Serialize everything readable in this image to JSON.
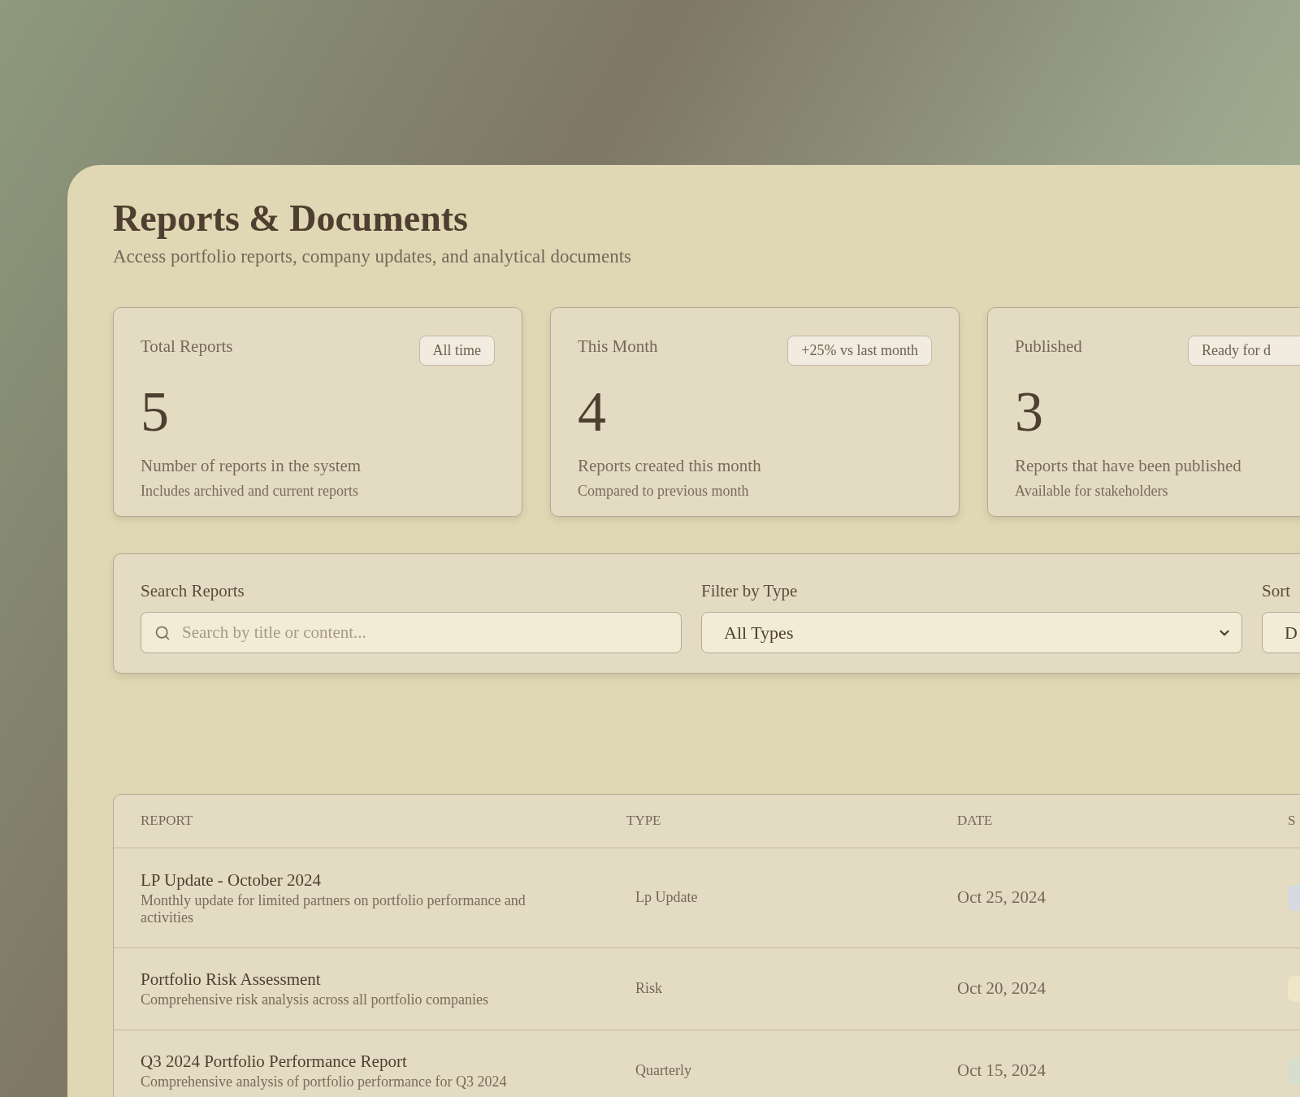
{
  "header": {
    "title": "Reports & Documents",
    "subtitle": "Access portfolio reports, company updates, and analytical documents"
  },
  "stats": [
    {
      "label": "Total Reports",
      "badge": "All time",
      "value": "5",
      "description": "Number of reports in the system",
      "note": "Includes archived and current reports"
    },
    {
      "label": "This Month",
      "badge": "+25% vs last month",
      "value": "4",
      "description": "Reports created this month",
      "note": "Compared to previous month"
    },
    {
      "label": "Published",
      "badge": "Ready for d",
      "value": "3",
      "description": "Reports that have been published",
      "note": "Available for stakeholders"
    }
  ],
  "filters": {
    "search": {
      "label": "Search Reports",
      "placeholder": "Search by title or content..."
    },
    "type": {
      "label": "Filter by Type",
      "value": "All Types"
    },
    "sort": {
      "label": "Sort",
      "value": "D"
    }
  },
  "table": {
    "columns": [
      "REPORT",
      "TYPE",
      "DATE",
      "S"
    ],
    "rows": [
      {
        "title": "LP Update - October 2024",
        "description": "Monthly update for limited partners on portfolio performance and activities",
        "type": "Lp Update",
        "date": "Oct 25, 2024",
        "color": "#d5dae0"
      },
      {
        "title": "Portfolio Risk Assessment",
        "description": "Comprehensive risk analysis across all portfolio companies",
        "type": "Risk",
        "date": "Oct 20, 2024",
        "color": "#efe6c9"
      },
      {
        "title": "Q3 2024 Portfolio Performance Report",
        "description": "Comprehensive analysis of portfolio performance for Q3 2024",
        "type": "Quarterly",
        "date": "Oct 15, 2024",
        "color": "#d6dfcb"
      }
    ]
  }
}
